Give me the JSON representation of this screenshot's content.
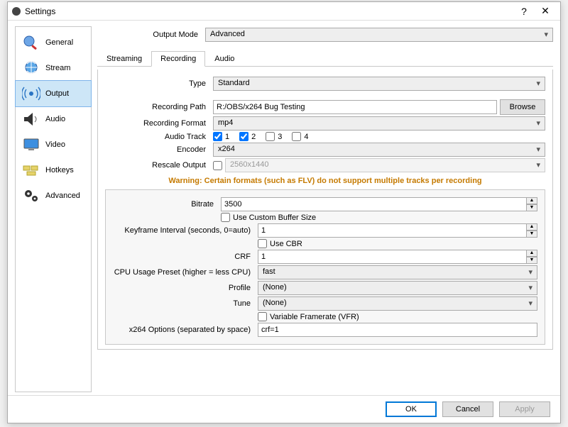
{
  "window": {
    "title": "Settings",
    "help": "?",
    "close": "✕"
  },
  "sidebar": {
    "items": [
      {
        "label": "General"
      },
      {
        "label": "Stream"
      },
      {
        "label": "Output"
      },
      {
        "label": "Audio"
      },
      {
        "label": "Video"
      },
      {
        "label": "Hotkeys"
      },
      {
        "label": "Advanced"
      }
    ]
  },
  "outputMode": {
    "label": "Output Mode",
    "value": "Advanced"
  },
  "tabs": {
    "streaming": "Streaming",
    "recording": "Recording",
    "audio": "Audio"
  },
  "rec": {
    "typeLabel": "Type",
    "typeValue": "Standard",
    "pathLabel": "Recording Path",
    "pathValue": "R:/OBS/x264 Bug Testing",
    "browse": "Browse",
    "formatLabel": "Recording Format",
    "formatValue": "mp4",
    "audioTrackLabel": "Audio Track",
    "track1": "1",
    "track2": "2",
    "track3": "3",
    "track4": "4",
    "encoderLabel": "Encoder",
    "encoderValue": "x264",
    "rescaleLabel": "Rescale Output",
    "rescaleValue": "2560x1440",
    "warning": "Warning: Certain formats (such as FLV) do not support multiple tracks per recording"
  },
  "enc": {
    "bitrateLabel": "Bitrate",
    "bitrateValue": "3500",
    "customBuffer": "Use Custom Buffer Size",
    "keyframeLabel": "Keyframe Interval (seconds, 0=auto)",
    "keyframeValue": "1",
    "useCBR": "Use CBR",
    "crfLabel": "CRF",
    "crfValue": "1",
    "cpuLabel": "CPU Usage Preset (higher = less CPU)",
    "cpuValue": "fast",
    "profileLabel": "Profile",
    "profileValue": "(None)",
    "tuneLabel": "Tune",
    "tuneValue": "(None)",
    "vfr": "Variable Framerate (VFR)",
    "x264OptsLabel": "x264 Options (separated by space)",
    "x264OptsValue": "crf=1"
  },
  "footer": {
    "ok": "OK",
    "cancel": "Cancel",
    "apply": "Apply"
  }
}
